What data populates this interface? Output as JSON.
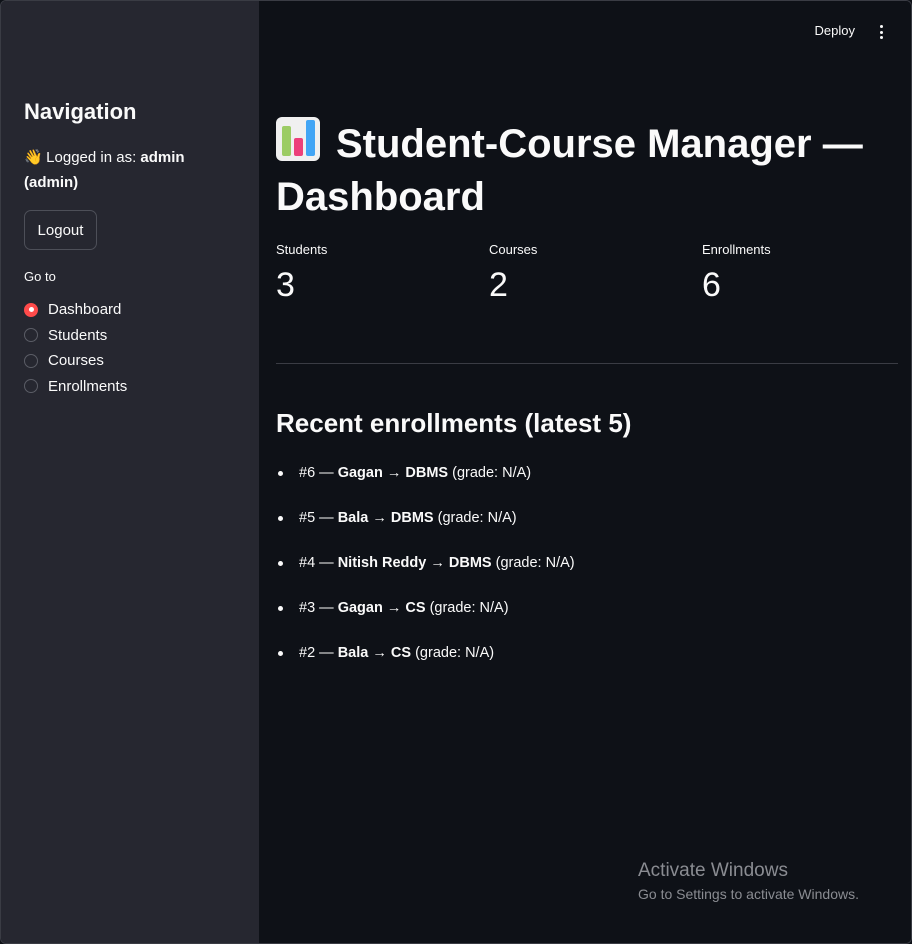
{
  "sidebar": {
    "title": "Navigation",
    "logged_prefix": "Logged in as:",
    "user": "admin",
    "role": "(admin)",
    "logout_label": "Logout",
    "goto_label": "Go to",
    "nav_options": [
      {
        "label": "Dashboard",
        "selected": true
      },
      {
        "label": "Students",
        "selected": false
      },
      {
        "label": "Courses",
        "selected": false
      },
      {
        "label": "Enrollments",
        "selected": false
      }
    ]
  },
  "header": {
    "deploy_label": "Deploy"
  },
  "main": {
    "title": "Student-Course Manager — Dashboard",
    "metrics": [
      {
        "label": "Students",
        "value": "3"
      },
      {
        "label": "Courses",
        "value": "2"
      },
      {
        "label": "Enrollments",
        "value": "6"
      }
    ],
    "recent_title": "Recent enrollments (latest 5)",
    "enrollments": [
      {
        "id": "#6",
        "student": "Gagan",
        "course": "DBMS",
        "grade": "(grade: N/A)"
      },
      {
        "id": "#5",
        "student": "Bala",
        "course": "DBMS",
        "grade": "(grade: N/A)"
      },
      {
        "id": "#4",
        "student": "Nitish Reddy",
        "course": "DBMS",
        "grade": "(grade: N/A)"
      },
      {
        "id": "#3",
        "student": "Gagan",
        "course": "CS",
        "grade": "(grade: N/A)"
      },
      {
        "id": "#2",
        "student": "Bala",
        "course": "CS",
        "grade": "(grade: N/A)"
      }
    ]
  },
  "watermark": {
    "line1": "Activate Windows",
    "line2": "Go to Settings to activate Windows."
  },
  "colors": {
    "accent": "#ff4b4b",
    "sidebar_bg": "#262730",
    "main_bg": "#0e1117"
  }
}
